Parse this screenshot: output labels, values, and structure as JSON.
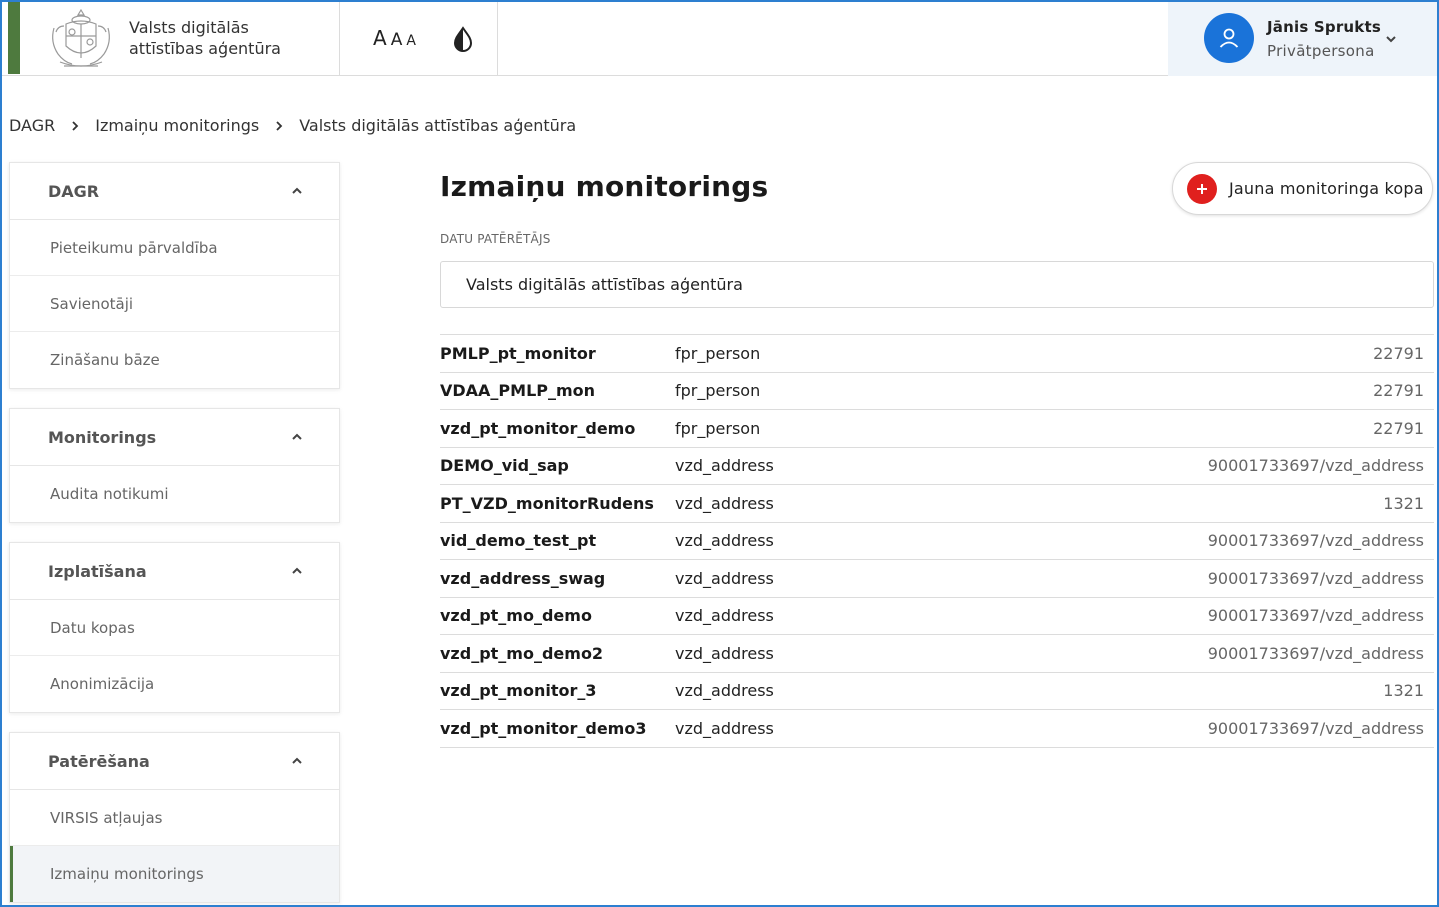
{
  "header": {
    "org_name_line1": "Valsts digitālās",
    "org_name_line2": "attīstības aģentūra",
    "font_size_labels": [
      "A",
      "A",
      "A"
    ],
    "contrast_icon": "contrast-drop-icon",
    "user": {
      "name": "Jānis Sprukts",
      "role": "Privātpersona",
      "avatar_icon": "user-icon",
      "avatar_color": "#1a73d9"
    },
    "accent_color": "#4e7a3e"
  },
  "breadcrumb": [
    "DAGR",
    "Izmaiņu monitorings",
    "Valsts digitālās attīstības aģentūra"
  ],
  "sidebar": {
    "groups": [
      {
        "title": "DAGR",
        "items": [
          {
            "label": "Pieteikumu pārvaldība"
          },
          {
            "label": "Savienotāji"
          },
          {
            "label": "Zināšanu bāze"
          }
        ]
      },
      {
        "title": "Monitorings",
        "items": [
          {
            "label": "Audita notikumi"
          }
        ]
      },
      {
        "title": "Izplatīšana",
        "items": [
          {
            "label": "Datu kopas"
          },
          {
            "label": "Anonimizācija"
          }
        ]
      },
      {
        "title": "Patērēšana",
        "items": [
          {
            "label": "VIRSIS atļaujas"
          },
          {
            "label": "Izmaiņu monitorings",
            "active": true
          }
        ]
      }
    ]
  },
  "main": {
    "title": "Izmaiņu monitorings",
    "new_button_label": "Jauna monitoringa kopa",
    "new_button_color": "#e0201e",
    "consumer_label": "DATU PATĒRĒTĀJS",
    "consumer_value": "Valsts digitālās attīstības aģentūra",
    "rows": [
      {
        "name": "PMLP_pt_monitor",
        "type": "fpr_person",
        "value": "22791"
      },
      {
        "name": "VDAA_PMLP_mon",
        "type": "fpr_person",
        "value": "22791"
      },
      {
        "name": "vzd_pt_monitor_demo",
        "type": "fpr_person",
        "value": "22791"
      },
      {
        "name": "DEMO_vid_sap",
        "type": "vzd_address",
        "value": "90001733697/vzd_address"
      },
      {
        "name": "PT_VZD_monitorRudens",
        "type": "vzd_address",
        "value": "1321"
      },
      {
        "name": "vid_demo_test_pt",
        "type": "vzd_address",
        "value": "90001733697/vzd_address"
      },
      {
        "name": "vzd_address_swag",
        "type": "vzd_address",
        "value": "90001733697/vzd_address"
      },
      {
        "name": "vzd_pt_mo_demo",
        "type": "vzd_address",
        "value": "90001733697/vzd_address"
      },
      {
        "name": "vzd_pt_mo_demo2",
        "type": "vzd_address",
        "value": "90001733697/vzd_address"
      },
      {
        "name": "vzd_pt_monitor_3",
        "type": "vzd_address",
        "value": "1321"
      },
      {
        "name": "vzd_pt_monitor_demo3",
        "type": "vzd_address",
        "value": "90001733697/vzd_address"
      }
    ]
  }
}
